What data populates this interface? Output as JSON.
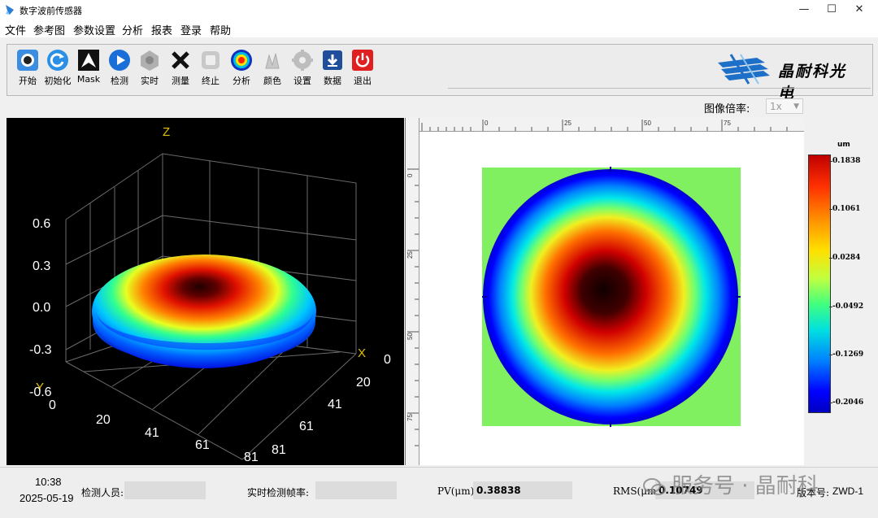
{
  "window": {
    "title": "数字波前传感器",
    "controls": {
      "minimize": "—",
      "maximize": "☐",
      "close": "✕"
    }
  },
  "menu": [
    "文件",
    "参考图",
    "参数设置",
    "分析",
    "报表",
    "登录",
    "帮助"
  ],
  "toolbar": [
    {
      "label": "开始",
      "icon": "start-icon"
    },
    {
      "label": "初始化",
      "icon": "initialize-icon"
    },
    {
      "label": "Mask",
      "icon": "mask-icon"
    },
    {
      "label": "检测",
      "icon": "detect-icon"
    },
    {
      "label": "实时",
      "icon": "realtime-icon"
    },
    {
      "label": "测量",
      "icon": "measure-icon"
    },
    {
      "label": "终止",
      "icon": "stop-icon"
    },
    {
      "label": "分析",
      "icon": "analysis-icon"
    },
    {
      "label": "颜色",
      "icon": "color-icon"
    },
    {
      "label": "设置",
      "icon": "settings-icon"
    },
    {
      "label": "数据",
      "icon": "data-icon"
    },
    {
      "label": "退出",
      "icon": "exit-icon"
    }
  ],
  "brand": {
    "name": "晶耐科光电"
  },
  "zoom": {
    "label": "图像倍率:",
    "value": "1x"
  },
  "plot3d": {
    "z_axis_label": "Z",
    "x_axis_label": "X",
    "y_axis_label": "Y",
    "z_ticks": [
      "0.6",
      "0.3",
      "0.0",
      "-0.3",
      "-0.6"
    ],
    "y_ticks": [
      "0",
      "20",
      "41",
      "61",
      "81"
    ],
    "x_ticks": [
      "0",
      "20",
      "41",
      "61",
      "81"
    ]
  },
  "plot2d": {
    "ruler_top": [
      "0",
      "25",
      "50",
      "75"
    ],
    "ruler_left": [
      "0",
      "25",
      "50",
      "75"
    ]
  },
  "colorbar": {
    "unit": "um",
    "ticks": [
      "0.1838",
      "0.1061",
      "0.0284",
      "-0.0492",
      "-0.1269",
      "-0.2046"
    ]
  },
  "status": {
    "time": "10:38",
    "date": "2025-05-19",
    "inspector_label": "检测人员:",
    "inspector_value": "",
    "framerate_label": "实时检测帧率:",
    "framerate_value": "",
    "pv_label": "PV(μm):",
    "pv_value": "0.38838",
    "rms_label": "RMS(μm):",
    "rms_value": "0.10749",
    "version_label": "版本号:",
    "version_value": "ZWD-1"
  },
  "watermark": "服务号 · 晶耐科"
}
